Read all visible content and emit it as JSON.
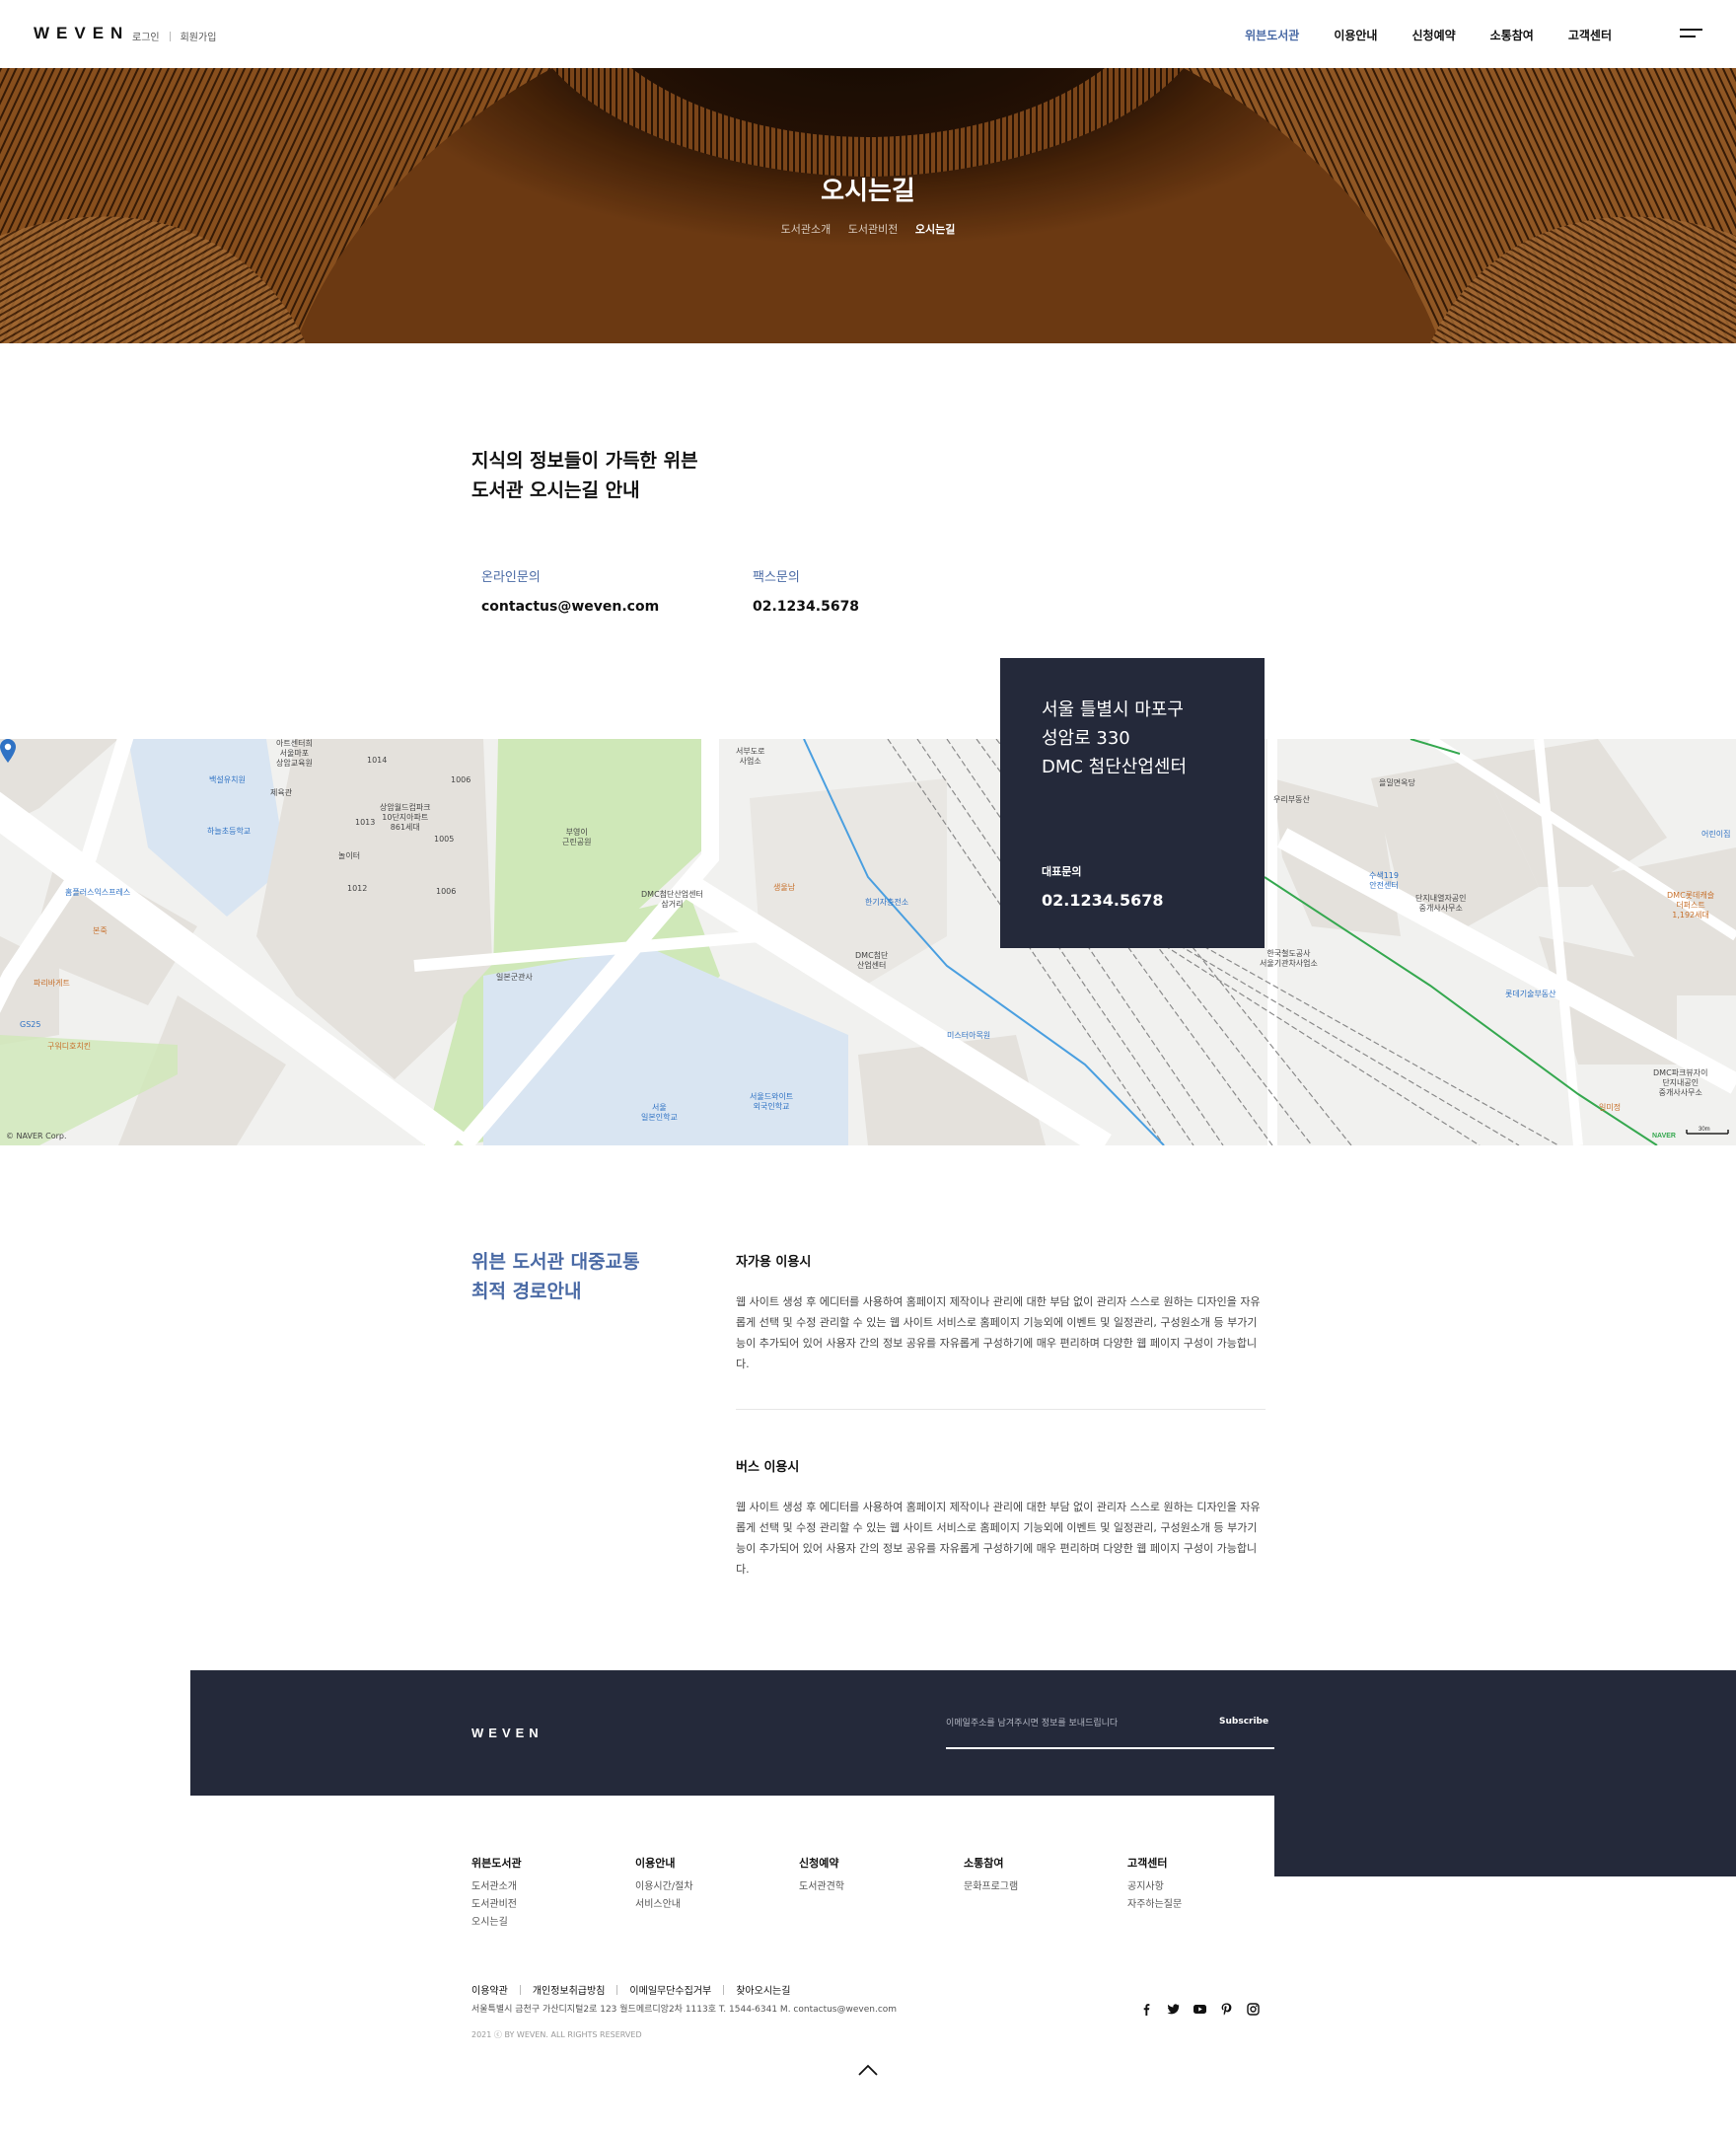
{
  "header": {
    "logo": "WEVEN",
    "login": "로그인",
    "join": "회원가입",
    "nav": [
      "위븐도서관",
      "이용안내",
      "신청예약",
      "소통참여",
      "고객센터"
    ],
    "active_nav": "위븐도서관",
    "menu_icon": "hamburger-icon"
  },
  "hero": {
    "title": "오시는길",
    "breadcrumb": [
      "도서관소개",
      "도서관비전",
      "오시는길"
    ]
  },
  "intro": {
    "title_line1": "지식의 정보들이 가득한 위븐",
    "title_line2": "도서관 오시는길 안내",
    "contacts": [
      {
        "label": "온라인문의",
        "value": "contactus@weven.com"
      },
      {
        "label": "팩스문의",
        "value": "02.1234.5678"
      }
    ]
  },
  "map": {
    "copyright": "© NAVER Corp.",
    "scale": "30m",
    "provider": "NAVER",
    "labels": {
      "l1": "아트센터희\n서울마포\n상암교육원",
      "l2": "1014",
      "l3": "1006",
      "l4": "상암월드컵파크\n10단지아파트\n861세대",
      "l5": "1013",
      "l6": "1005",
      "l7": "놀이터",
      "l8": "1012",
      "l9": "1006",
      "l10": "부영이\n근린공원",
      "l11": "서부도로\n사업소",
      "l12": "DMC첨단산업센터\n삼거리",
      "l13": "한기자층전소",
      "l14": "DMC첨단\n산업센터",
      "l15": "미스터아목원",
      "l16": "서울\n일본인학교",
      "l17": "서울드와이트\n외국인학교",
      "l18": "우리부동산",
      "l19": "수색119\n안전센터",
      "l20": "단지내열자공인\n중개사사무소",
      "l21": "DMC롯데캐슬\n더퍼스트\n1,192세대",
      "l22": "한국철도공사\n서울기관차사업소",
      "l23": "롯데기술부동산",
      "l24": "DMC파크뷰자이\n단지내공인\n중개사사무소",
      "l25": "일미정",
      "l26": "어린이집",
      "l27": "을밀면옥당",
      "l28": "백설유치원",
      "l29": "하늘초등학교",
      "l30": "홈플러스익스프레스",
      "l31": "본죽",
      "l32": "파리바게트",
      "l33": "GS25",
      "l34": "구워디호치킨",
      "l35": "일본군관사",
      "l36": "생울남",
      "l37": "제육관"
    },
    "card": {
      "address_line1": "서울 틀별시 마포구",
      "address_line2": "성암로 330",
      "address_line3": "DMC 첨단산업센터",
      "tel_label": "대표문의",
      "tel": "02.1234.5678"
    }
  },
  "transport": {
    "title_line1": "위븐 도서관 대중교통",
    "title_line2": "최적 경로안내",
    "car": {
      "title": "자가용 이용시",
      "body": "웹 사이트 생성 후 에디터를 사용하여 홈페이지 제작이나 관리에 대한 부담 없이 관리자 스스로 원하는 디자인을 자유롭게 선택 및 수정 관리할 수 있는 웹 사이트 서비스로 홈페이지 기능외에 이벤트 및 일정관리, 구성원소개 등 부가기능이 추가되어 있어 사용자 간의 정보 공유를 자유롭게 구성하기에 매우 편리하며 다양한 웹 페이지 구성이 가능합니다."
    },
    "bus": {
      "title": "버스 이용시",
      "body": "웹 사이트 생성 후 에디터를 사용하여 홈페이지 제작이나 관리에 대한 부담 없이 관리자 스스로 원하는 디자인을 자유롭게 선택 및 수정 관리할 수 있는 웹 사이트 서비스로 홈페이지 기능외에 이벤트 및 일정관리, 구성원소개 등 부가기능이 추가되어 있어 사용자 간의 정보 공유를 자유롭게 구성하기에 매우 편리하며 다양한 웹 페이지 구성이 가능합니다."
    }
  },
  "footer": {
    "logo": "WEVEN",
    "subscribe_placeholder": "이메일주소를 남겨주시면 정보를 보내드립니다",
    "subscribe_button": "Subscribe",
    "columns": [
      {
        "title": "위븐도서관",
        "links": [
          "도서관소개",
          "도서관비전",
          "오시는길"
        ]
      },
      {
        "title": "이용안내",
        "links": [
          "이용시간/절차",
          "서비스안내"
        ]
      },
      {
        "title": "신청예약",
        "links": [
          "도서관견학"
        ]
      },
      {
        "title": "소통참여",
        "links": [
          "문화프로그램"
        ]
      },
      {
        "title": "고객센터",
        "links": [
          "공지사항",
          "자주하는질문"
        ]
      }
    ],
    "policy": [
      "이용약관",
      "개인정보취급방침",
      "이메일무단수집거부",
      "찾아오시는길"
    ],
    "info": "서울특별시 금천구 가산디지털2로 123 월드메르디앙2차 1113호   T. 1544-6341   M. contactus@weven.com",
    "copyright": "2021 ⓒ BY WEVEN. ALL RIGHTS RESERVED",
    "sns": [
      "facebook-icon",
      "twitter-icon",
      "youtube-icon",
      "pinterest-icon",
      "instagram-icon"
    ],
    "top_button": "chevron-up-icon"
  },
  "colors": {
    "accent": "#4a6aa5",
    "navy": "#24293a",
    "map_green": "#cfe8b8",
    "map_blue": "#d9e5f2"
  }
}
